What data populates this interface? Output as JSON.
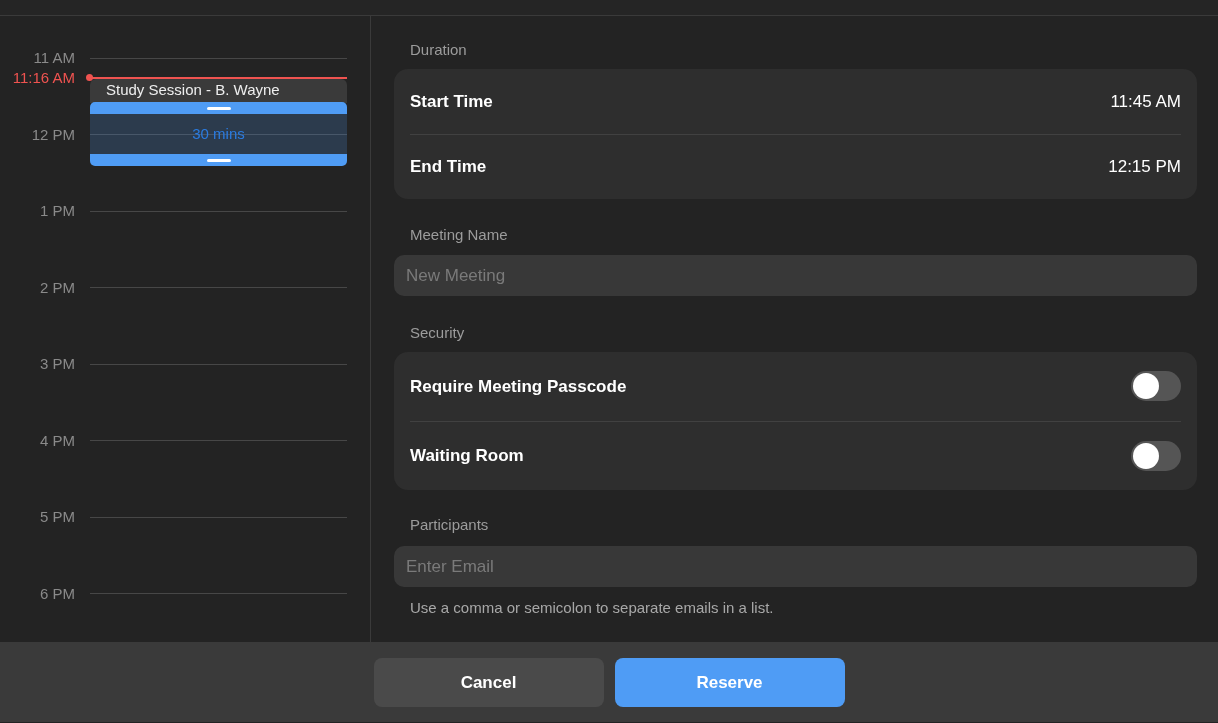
{
  "calendar": {
    "hours": [
      "11 AM",
      "12 PM",
      "1 PM",
      "2 PM",
      "3 PM",
      "4 PM",
      "5 PM",
      "6 PM"
    ],
    "now": {
      "label": "11:16 AM"
    },
    "events": [
      {
        "title": "Study Session - B. Wayne"
      }
    ],
    "selection": {
      "label": "30 mins"
    }
  },
  "duration": {
    "label": "Duration",
    "rows": [
      {
        "label": "Start Time",
        "value": "11:45 AM"
      },
      {
        "label": "End Time",
        "value": "12:15 PM"
      }
    ]
  },
  "meeting_name": {
    "label": "Meeting Name",
    "placeholder": "New Meeting"
  },
  "security": {
    "label": "Security",
    "options": [
      {
        "label": "Require Meeting Passcode",
        "on": false
      },
      {
        "label": "Waiting Room",
        "on": false
      }
    ]
  },
  "participants": {
    "label": "Participants",
    "placeholder": "Enter Email",
    "hint": "Use a comma or semicolon to separate emails in a list."
  },
  "buttons": [
    {
      "label": "Cancel",
      "kind": "secondary"
    },
    {
      "label": "Reserve",
      "kind": "primary"
    }
  ]
}
